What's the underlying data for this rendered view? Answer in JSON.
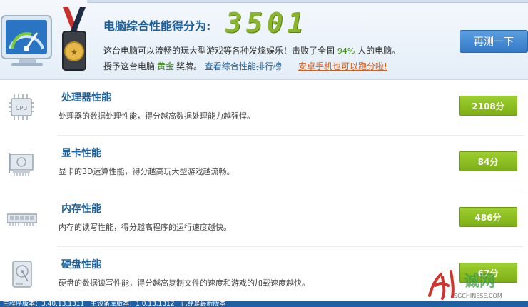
{
  "header": {
    "title": "电脑综合性能得分为:",
    "score": "3501",
    "desc_prefix": "这台电脑可以流畅的玩大型游戏等各种发烧娱乐！击败了全国",
    "beat_percent": "94%",
    "desc_suffix": "人的电脑。",
    "award_prefix": "授予这台电脑",
    "award_level": "黄金",
    "award_suffix": "奖牌。",
    "ranking_link": "查看综合性能排行榜",
    "android_link": "安卓手机也可以跑分啦!",
    "retest_label": "再测一下"
  },
  "rows": [
    {
      "name": "处理器性能",
      "desc": "处理器的数据处理性能，得分越高数据处理能力越强悍。",
      "score": "2108分",
      "icon": "cpu-icon"
    },
    {
      "name": "显卡性能",
      "desc": "显卡的3D运算性能，得分越高玩大型游戏越流畅。",
      "score": "84分",
      "icon": "graphics-card-icon"
    },
    {
      "name": "内存性能",
      "desc": "内存的读写性能，得分越高程序的运行速度越快。",
      "score": "486分",
      "icon": "memory-icon"
    },
    {
      "name": "硬盘性能",
      "desc": "硬盘的数据读写性能，得分越高复制文件的速度和游戏的加载速度越快。",
      "score": "67分",
      "icon": "hard-disk-icon"
    }
  ],
  "statusbar": {
    "text": "主程序版本：3.40.13.1311　主设备库版本：1.0.13.1312　已经是最新版本"
  },
  "watermark": {
    "text": "诚网",
    "sub": "SGCHINESE.COM"
  },
  "colors": {
    "accent_blue": "#1d5f98",
    "score_green": "#8ab62c",
    "badge_green": "#86b81e",
    "android_orange": "#e05a14"
  }
}
